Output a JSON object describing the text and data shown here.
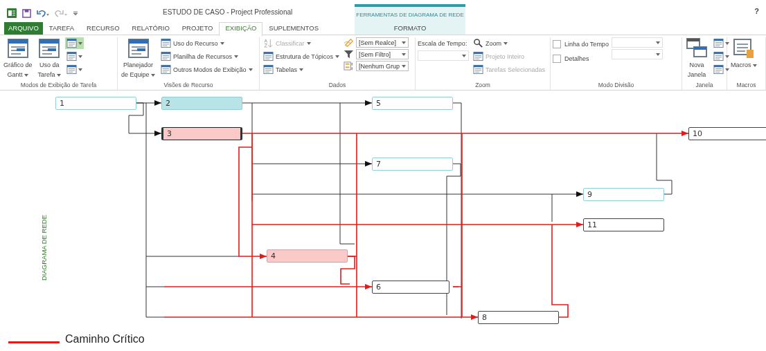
{
  "title_bar": {
    "title": "ESTUDO DE CASO - Project Professional",
    "context_title": "FERRAMENTAS DE DIAGRAMA DE REDE",
    "help": "?"
  },
  "tabs": [
    {
      "label": "ARQUIVO",
      "kind": "file",
      "selected": false
    },
    {
      "label": "TAREFA",
      "kind": "tab",
      "selected": false
    },
    {
      "label": "RECURSO",
      "kind": "tab",
      "selected": false
    },
    {
      "label": "RELATÓRIO",
      "kind": "tab",
      "selected": false
    },
    {
      "label": "PROJETO",
      "kind": "tab",
      "selected": false
    },
    {
      "label": "EXIBIÇÃO",
      "kind": "tab",
      "selected": true
    },
    {
      "label": "SUPLEMENTOS",
      "kind": "tab",
      "selected": false
    },
    {
      "label": "FORMATO",
      "kind": "context",
      "selected": false
    }
  ],
  "groups": [
    {
      "title": "Modos de Exibição de Tarefa",
      "columns": [
        [
          {
            "kind": "large",
            "lines": [
              "Gráfico de",
              "Gantt"
            ],
            "dropdown": true
          }
        ],
        [
          {
            "kind": "large",
            "lines": [
              "Uso da",
              "Tarefa"
            ],
            "dropdown": true
          }
        ],
        [
          {
            "kind": "icon",
            "selected": true
          },
          {
            "kind": "icon",
            "selected": false
          },
          {
            "kind": "icon",
            "selected": false
          }
        ]
      ]
    },
    {
      "title": "Visões de Recurso",
      "columns": [
        [
          {
            "kind": "large",
            "lines": [
              "Planejador",
              "de Equipe"
            ],
            "dropdown": true
          }
        ],
        [
          {
            "kind": "small",
            "label": "Uso do Recurso",
            "dropdown": true,
            "disabled": false
          },
          {
            "kind": "small",
            "label": "Planilha de Recursos",
            "dropdown": true,
            "disabled": false
          },
          {
            "kind": "small",
            "label": "Outros Modos de Exibição",
            "dropdown": true,
            "disabled": false
          }
        ]
      ]
    },
    {
      "title": "Dados",
      "columns": [
        [
          {
            "kind": "small",
            "label": "Classificar",
            "dropdown": true,
            "disabled": true
          },
          {
            "kind": "small",
            "label": "Estrutura de Tópicos",
            "dropdown": true,
            "disabled": false
          },
          {
            "kind": "small",
            "label": "Tabelas",
            "dropdown": true,
            "disabled": false
          }
        ],
        [
          {
            "kind": "combo",
            "value": "[Sem Realce]",
            "disabled": false
          },
          {
            "kind": "combo",
            "value": "[Sem Filtro]",
            "disabled": false
          },
          {
            "kind": "combo",
            "value": "[Nenhum Grup",
            "disabled": false
          }
        ]
      ]
    },
    {
      "title": "Zoom",
      "columns": [
        [
          {
            "kind": "text",
            "label": "Escala de Tempo:"
          },
          {
            "kind": "combo",
            "disabled": true
          }
        ],
        [
          {
            "kind": "small",
            "label": "Zoom",
            "dropdown": true,
            "disabled": false
          },
          {
            "kind": "small",
            "label": "Projeto Inteiro",
            "dropdown": false,
            "disabled": true
          },
          {
            "kind": "small",
            "label": "Tarefas Selecionadas",
            "dropdown": false,
            "disabled": true
          }
        ]
      ]
    },
    {
      "title": "Modo Divisão",
      "columns": [
        [
          {
            "kind": "check",
            "label": "Linha do Tempo",
            "checked": false
          },
          {
            "kind": "check",
            "label": "Detalhes",
            "checked": false
          }
        ],
        [
          {
            "kind": "combo",
            "disabled": true
          },
          {
            "kind": "combo",
            "disabled": true
          }
        ]
      ]
    },
    {
      "title": "Janela",
      "columns": [
        [
          {
            "kind": "large",
            "lines": [
              "Nova",
              "Janela"
            ],
            "dropdown": false
          }
        ],
        [
          {
            "kind": "icon",
            "selected": false
          },
          {
            "kind": "icon",
            "selected": false
          },
          {
            "kind": "icon",
            "selected": false
          }
        ]
      ]
    },
    {
      "title": "Macros",
      "columns": [
        [
          {
            "kind": "large",
            "lines": [
              "Macros"
            ],
            "dropdown": true
          }
        ]
      ]
    }
  ],
  "side_label": "DIAGRAMA DE REDE",
  "nodes": [
    {
      "label": "1",
      "critical": false,
      "highlighted": false,
      "selected": false
    },
    {
      "label": "2",
      "critical": false,
      "highlighted": true,
      "selected": false
    },
    {
      "label": "5",
      "critical": false,
      "highlighted": false,
      "selected": false
    },
    {
      "label": "3",
      "critical": true,
      "highlighted": true,
      "selected": true
    },
    {
      "label": "10",
      "critical": true,
      "highlighted": false,
      "selected": false
    },
    {
      "label": "7",
      "critical": false,
      "highlighted": false,
      "selected": false
    },
    {
      "label": "9",
      "critical": false,
      "highlighted": false,
      "selected": false
    },
    {
      "label": "11",
      "critical": true,
      "highlighted": false,
      "selected": false
    },
    {
      "label": "4",
      "critical": true,
      "highlighted": true,
      "selected": false
    },
    {
      "label": "6",
      "critical": true,
      "highlighted": false,
      "selected": false
    },
    {
      "label": "8",
      "critical": true,
      "highlighted": false,
      "selected": false
    }
  ],
  "legend": {
    "label": "Caminho Crítico"
  }
}
